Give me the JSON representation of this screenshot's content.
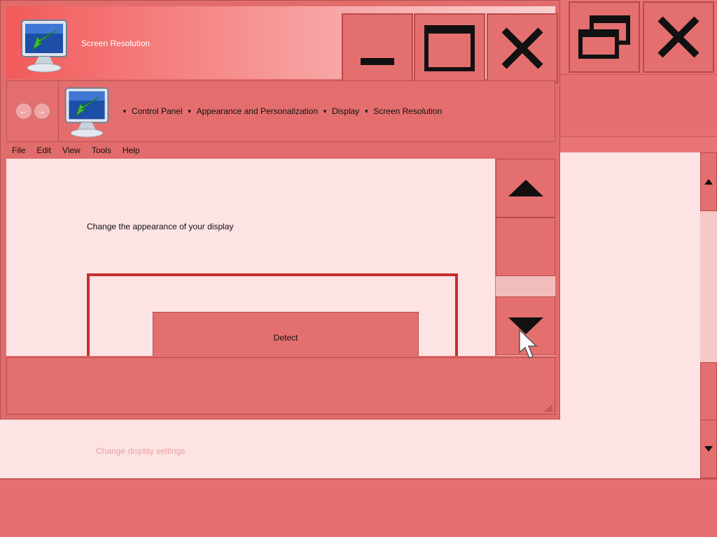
{
  "background_window": {
    "faded_text": "Change display settings"
  },
  "window": {
    "title": "Screen Resolution",
    "buttons": {
      "minimize": "minimize",
      "maximize": "maximize",
      "close": "close"
    }
  },
  "breadcrumb": {
    "items": [
      "Control Panel",
      "Appearance and Personalization",
      "Display",
      "Screen Resolution"
    ]
  },
  "menu": {
    "items": [
      "File",
      "Edit",
      "View",
      "Tools",
      "Help"
    ]
  },
  "content": {
    "heading": "Change the appearance of your display",
    "detect_button": "Detect"
  },
  "colors": {
    "accent": "#e46f6f",
    "title_gradient_start": "#f25a5a",
    "frame_red": "#c62f2f",
    "content_bg": "#fde3e3"
  }
}
